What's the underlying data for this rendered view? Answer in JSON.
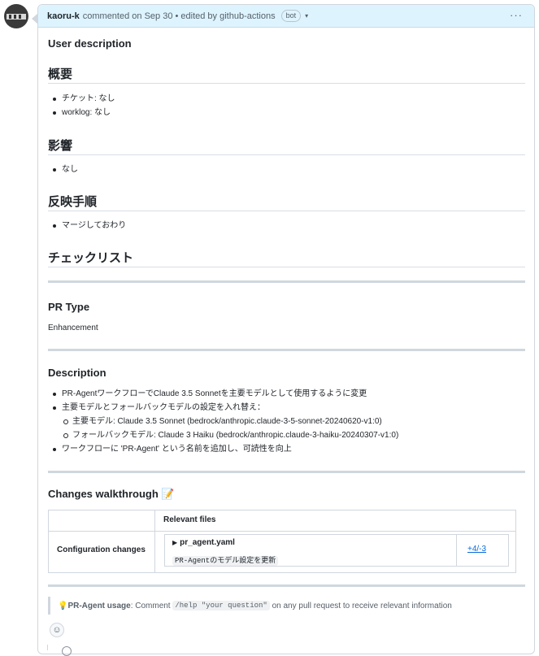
{
  "comment": {
    "author": "kaoru-k",
    "action": "commented on Sep 30 • edited by github-actions",
    "badge": "bot",
    "caret_icon": "▾",
    "more_icon": "···"
  },
  "sections": {
    "user_description": "User description",
    "overview_heading": "概要",
    "overview_items": [
      "チケット: なし",
      "worklog: なし"
    ],
    "impact_heading": "影響",
    "impact_items": [
      "なし"
    ],
    "apply_heading": "反映手順",
    "apply_items": [
      "マージしておわり"
    ],
    "checklist_heading": "チェックリスト",
    "pr_type_heading": "PR Type",
    "pr_type_value": "Enhancement",
    "description_heading": "Description",
    "description_items": [
      "PR-AgentワークフローでClaude 3.5 Sonnetを主要モデルとして使用するように変更",
      "主要モデルとフォールバックモデルの設定を入れ替え：",
      "主要モデル: Claude 3.5 Sonnet (bedrock/anthropic.claude-3-5-sonnet-20240620-v1:0)",
      "フォールバックモデル: Claude 3 Haiku (bedrock/anthropic.claude-3-haiku-20240307-v1:0)",
      "ワークフローに 'PR-Agent' という名前を追加し、可読性を向上"
    ],
    "walkthrough_heading": "Changes walkthrough",
    "walkthrough_emoji": "📝"
  },
  "table": {
    "header": "Relevant files",
    "row_label": "Configuration changes",
    "file_name": "pr_agent.yaml",
    "file_desc": "PR-Agentのモデル設定を更新",
    "diff": "+4/-3",
    "expand_icon": "▶"
  },
  "usage": {
    "icon": "💡",
    "label": "PR-Agent usage",
    "text_before": ": Comment ",
    "code": "/help \"your question\"",
    "text_after": " on any pull request to receive relevant information"
  },
  "reaction_icon": "☺"
}
